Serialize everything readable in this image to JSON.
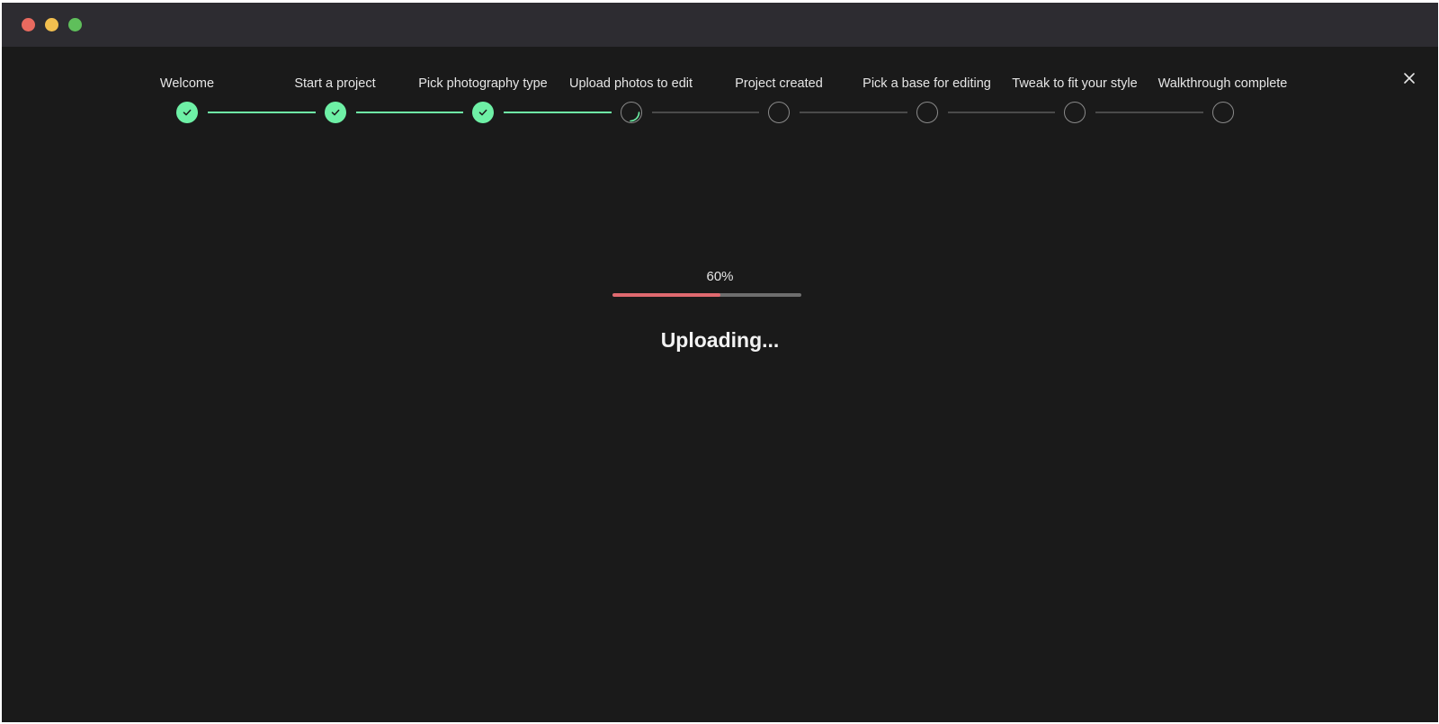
{
  "window": {
    "controls": [
      "close",
      "minimize",
      "zoom"
    ]
  },
  "stepper": {
    "steps": [
      {
        "label": "Welcome",
        "state": "done"
      },
      {
        "label": "Start a project",
        "state": "done"
      },
      {
        "label": "Pick photography type",
        "state": "done"
      },
      {
        "label": "Upload photos to edit",
        "state": "active"
      },
      {
        "label": "Project created",
        "state": "pending"
      },
      {
        "label": "Pick a base for editing",
        "state": "pending"
      },
      {
        "label": "Tweak to fit your style",
        "state": "pending"
      },
      {
        "label": "Walkthrough complete",
        "state": "pending"
      }
    ]
  },
  "upload": {
    "percent_label": "60%",
    "progress": 0.57,
    "status": "Uploading..."
  },
  "colors": {
    "accent_done": "#6ef0a6",
    "progress_fill": "#e0696f",
    "background": "#1a1a1a",
    "titlebar": "#2d2c31"
  },
  "icons": {
    "close": "close-icon",
    "check": "check-icon",
    "spinner": "spinner-icon"
  }
}
